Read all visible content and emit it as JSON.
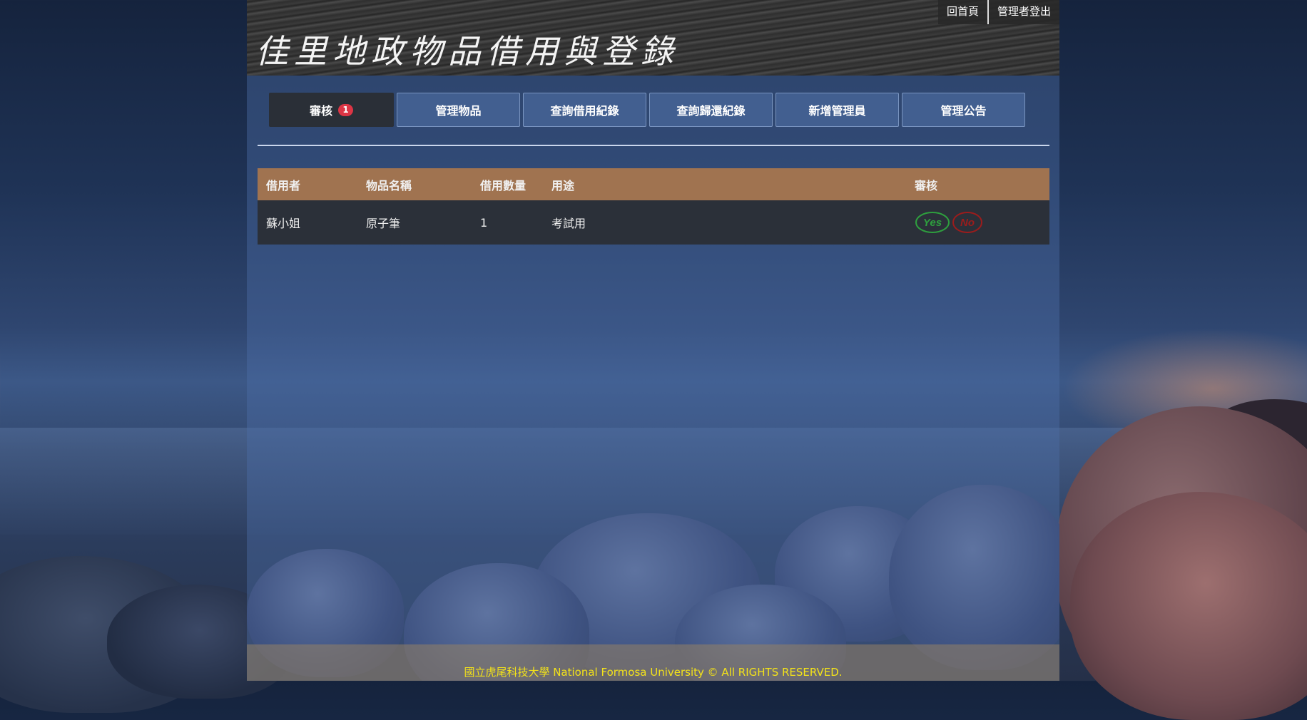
{
  "header": {
    "title": "佳里地政物品借用與登錄",
    "links": [
      {
        "label": "回首頁"
      },
      {
        "label": "管理者登出"
      }
    ]
  },
  "tabs": [
    {
      "label": "審核",
      "badge": "1",
      "active": true
    },
    {
      "label": "管理物品"
    },
    {
      "label": "查詢借用紀錄"
    },
    {
      "label": "查詢歸還紀錄"
    },
    {
      "label": "新增管理員"
    },
    {
      "label": "管理公告"
    }
  ],
  "table": {
    "headers": [
      "借用者",
      "物品名稱",
      "借用數量",
      "用途",
      "審核"
    ],
    "rows": [
      {
        "borrower": "蘇小姐",
        "item": "原子筆",
        "quantity": "1",
        "purpose": "考試用",
        "approve_label": "Yes",
        "reject_label": "No"
      }
    ]
  },
  "colors": {
    "header_row": "#a07350",
    "badge": "#dc3545",
    "yes": "#2e9e3e",
    "no": "#9b1c1c",
    "footer_text": "#f3e21a"
  },
  "footer": {
    "text": "國立虎尾科技大學 National Formosa University © All RIGHTS RESERVED."
  }
}
